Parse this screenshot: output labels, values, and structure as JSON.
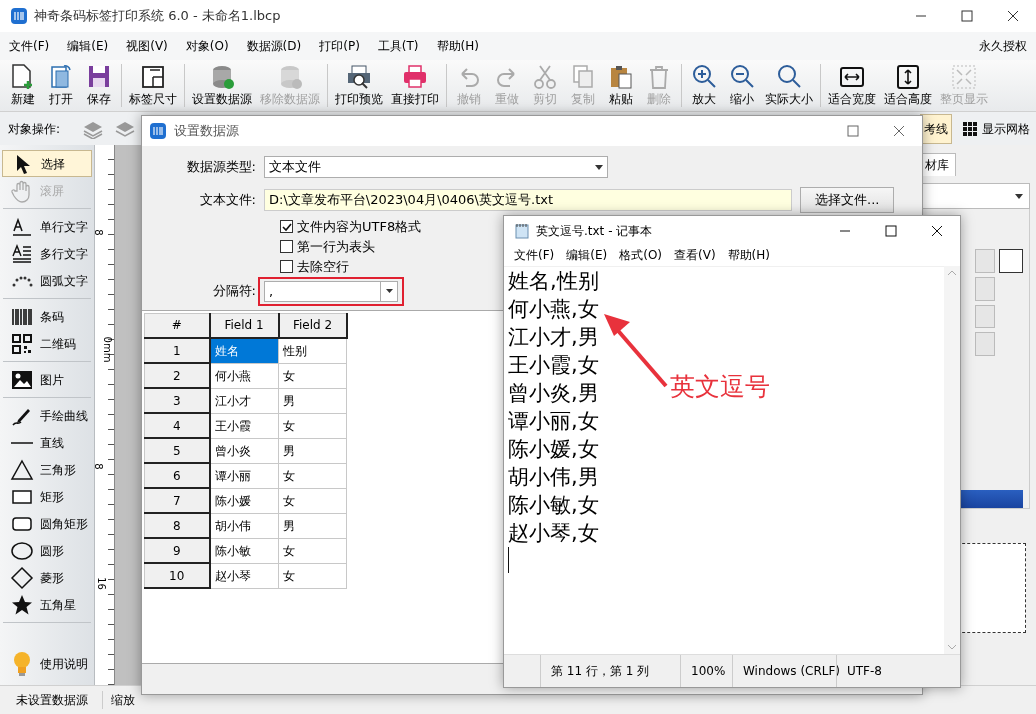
{
  "app": {
    "title": "神奇条码标签打印系统 6.0 - 未命名1.lbcp",
    "menu": [
      "文件(F)",
      "编辑(E)",
      "视图(V)",
      "对象(O)",
      "数据源(D)",
      "打印(P)",
      "工具(T)",
      "帮助(H)"
    ],
    "license": "永久授权",
    "toolbar": [
      [
        {
          "label": "新建",
          "disabled": false
        },
        {
          "label": "打开",
          "disabled": false
        },
        {
          "label": "保存",
          "disabled": false
        }
      ],
      [
        {
          "label": "标签尺寸",
          "disabled": false
        }
      ],
      [
        {
          "label": "设置数据源",
          "disabled": false
        },
        {
          "label": "移除数据源",
          "disabled": true
        }
      ],
      [
        {
          "label": "打印预览",
          "disabled": false
        },
        {
          "label": "直接打印",
          "disabled": false
        }
      ],
      [
        {
          "label": "撤销",
          "disabled": true
        },
        {
          "label": "重做",
          "disabled": true
        },
        {
          "label": "剪切",
          "disabled": true
        },
        {
          "label": "复制",
          "disabled": true
        },
        {
          "label": "粘贴",
          "disabled": false
        },
        {
          "label": "删除",
          "disabled": true
        }
      ],
      [
        {
          "label": "放大",
          "disabled": false
        },
        {
          "label": "缩小",
          "disabled": false
        },
        {
          "label": "实际大小",
          "disabled": false
        }
      ],
      [
        {
          "label": "适合宽度",
          "disabled": false
        },
        {
          "label": "适合高度",
          "disabled": false
        },
        {
          "label": "整页显示",
          "disabled": true
        }
      ]
    ],
    "object_bar": "对象操作:",
    "guides_toggle": {
      "label": "考线",
      "on": true
    },
    "grid_toggle": {
      "label": "显示网格",
      "on": false
    },
    "tools": [
      [
        {
          "label": "选择",
          "selected": true,
          "disabled": false
        },
        {
          "label": "滚屏",
          "selected": false,
          "disabled": true
        }
      ],
      [
        {
          "label": "单行文字",
          "selected": false,
          "disabled": false
        },
        {
          "label": "多行文字",
          "selected": false,
          "disabled": false
        },
        {
          "label": "圆弧文字",
          "selected": false,
          "disabled": false
        }
      ],
      [
        {
          "label": "条码",
          "selected": false,
          "disabled": false
        },
        {
          "label": "二维码",
          "selected": false,
          "disabled": false
        }
      ],
      [
        {
          "label": "图片",
          "selected": false,
          "disabled": false
        }
      ],
      [
        {
          "label": "手绘曲线",
          "selected": false,
          "disabled": false
        },
        {
          "label": "直线",
          "selected": false,
          "disabled": false
        },
        {
          "label": "三角形",
          "selected": false,
          "disabled": false
        },
        {
          "label": "矩形",
          "selected": false,
          "disabled": false
        },
        {
          "label": "圆角矩形",
          "selected": false,
          "disabled": false
        },
        {
          "label": "圆形",
          "selected": false,
          "disabled": false
        },
        {
          "label": "菱形",
          "selected": false,
          "disabled": false
        },
        {
          "label": "五角星",
          "selected": false,
          "disabled": false
        }
      ]
    ],
    "help": "使用说明",
    "ruler": [
      "8",
      "0mm",
      "8",
      "16"
    ],
    "side_tab": "材库",
    "status_bar": [
      "未设置数据源",
      "缩放"
    ]
  },
  "dialog": {
    "title": "设置数据源",
    "source_type": {
      "label": "数据源类型:",
      "value": "文本文件"
    },
    "text_file": {
      "label": "文本文件:",
      "value": "D:\\文章发布平台\\2023\\04月\\0406\\英文逗号.txt",
      "button": "选择文件..."
    },
    "options": [
      {
        "label": "文件内容为UTF8格式",
        "checked": true
      },
      {
        "label": "第一行为表头",
        "checked": false
      },
      {
        "label": "去除空行",
        "checked": false
      }
    ],
    "separator": {
      "label": "分隔符:",
      "value": ",",
      "highlighted": true
    },
    "table": {
      "columns": [
        "#",
        "Field 1",
        "Field 2"
      ],
      "rows": [
        {
          "cells": [
            {
              "text": "1",
              "selected": false
            },
            {
              "text": "姓名",
              "selected": true
            },
            {
              "text": "性别",
              "selected": false
            }
          ]
        },
        {
          "cells": [
            {
              "text": "2",
              "selected": false
            },
            {
              "text": "何小燕",
              "selected": false
            },
            {
              "text": "女",
              "selected": false
            }
          ]
        },
        {
          "cells": [
            {
              "text": "3",
              "selected": false
            },
            {
              "text": "江小才",
              "selected": false
            },
            {
              "text": "男",
              "selected": false
            }
          ]
        },
        {
          "cells": [
            {
              "text": "4",
              "selected": false
            },
            {
              "text": "王小霞",
              "selected": false
            },
            {
              "text": "女",
              "selected": false
            }
          ]
        },
        {
          "cells": [
            {
              "text": "5",
              "selected": false
            },
            {
              "text": "曾小炎",
              "selected": false
            },
            {
              "text": "男",
              "selected": false
            }
          ]
        },
        {
          "cells": [
            {
              "text": "6",
              "selected": false
            },
            {
              "text": "谭小丽",
              "selected": false
            },
            {
              "text": "女",
              "selected": false
            }
          ]
        },
        {
          "cells": [
            {
              "text": "7",
              "selected": false
            },
            {
              "text": "陈小媛",
              "selected": false
            },
            {
              "text": "女",
              "selected": false
            }
          ]
        },
        {
          "cells": [
            {
              "text": "8",
              "selected": false
            },
            {
              "text": "胡小伟",
              "selected": false
            },
            {
              "text": "男",
              "selected": false
            }
          ]
        },
        {
          "cells": [
            {
              "text": "9",
              "selected": false
            },
            {
              "text": "陈小敏",
              "selected": false
            },
            {
              "text": "女",
              "selected": false
            }
          ]
        },
        {
          "cells": [
            {
              "text": "10",
              "selected": false
            },
            {
              "text": "赵小琴",
              "selected": false
            },
            {
              "text": "女",
              "selected": false
            }
          ]
        }
      ]
    }
  },
  "notepad": {
    "title": "英文逗号.txt - 记事本",
    "menu": [
      "文件(F)",
      "编辑(E)",
      "格式(O)",
      "查看(V)",
      "帮助(H)"
    ],
    "lines": [
      "姓名,性别",
      "何小燕,女",
      "江小才,男",
      "王小霞,女",
      "曾小炎,男",
      "谭小丽,女",
      "陈小媛,女",
      "胡小伟,男",
      "陈小敏,女",
      "赵小琴,女"
    ],
    "status": [
      "第 11 行，第 1 列",
      "100%",
      "Windows (CRLF)",
      "UTF-8"
    ]
  },
  "annotation": {
    "text": "英文逗号"
  }
}
